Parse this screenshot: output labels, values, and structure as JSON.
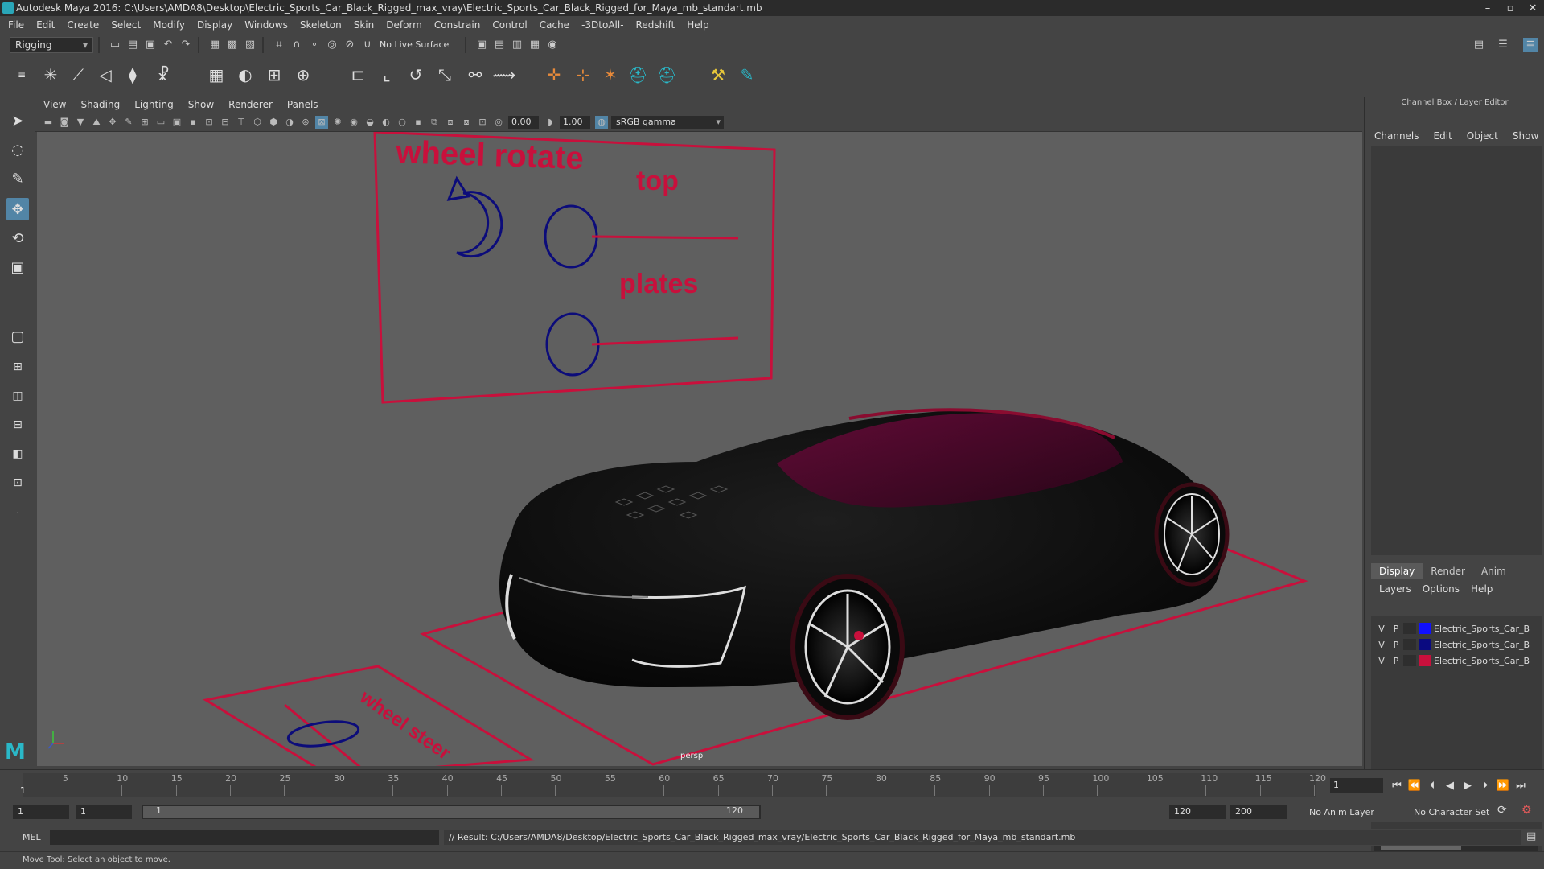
{
  "window": {
    "title": "Autodesk Maya 2016: C:\\Users\\AMDA8\\Desktop\\Electric_Sports_Car_Black_Rigged_max_vray\\Electric_Sports_Car_Black_Rigged_for_Maya_mb_standart.mb",
    "minimize": "–",
    "maximize": "▫",
    "close": "✕"
  },
  "menubar": [
    "File",
    "Edit",
    "Create",
    "Select",
    "Modify",
    "Display",
    "Windows",
    "Skeleton",
    "Skin",
    "Deform",
    "Constrain",
    "Control",
    "Cache",
    "-3DtoAll-",
    "Redshift",
    "Help"
  ],
  "statusline": {
    "mode": "Rigging",
    "live_surface": "No Live Surface"
  },
  "viewport": {
    "menus": [
      "View",
      "Shading",
      "Lighting",
      "Show",
      "Renderer",
      "Panels"
    ],
    "exposure": "0.00",
    "gamma_value": "1.00",
    "color_space": "sRGB gamma",
    "camera": "persp",
    "rig_labels": {
      "wheel_rotate": "wheel rotate",
      "top": "top",
      "plates": "plates",
      "wheel_steer": "wheel steer"
    },
    "colors": {
      "background": "#5f5f5f",
      "control_red": "#c8103c",
      "control_blue": "#0c0c7a"
    }
  },
  "channel_box": {
    "title": "Channel Box / Layer Editor",
    "menus": [
      "Channels",
      "Edit",
      "Object",
      "Show"
    ],
    "tabs": [
      "Display",
      "Render",
      "Anim"
    ],
    "layer_menus": [
      "Layers",
      "Options",
      "Help"
    ],
    "layers": [
      {
        "v": "V",
        "p": "P",
        "color": "#1010ff",
        "name": "Electric_Sports_Car_Bla"
      },
      {
        "v": "V",
        "p": "P",
        "color": "#0a0a80",
        "name": "Electric_Sports_Car_Bla"
      },
      {
        "v": "V",
        "p": "P",
        "color": "#c8103c",
        "name": "Electric_Sports_Car_Bla"
      }
    ]
  },
  "timeline": {
    "ticks": [
      "5",
      "10",
      "15",
      "20",
      "25",
      "30",
      "35",
      "40",
      "45",
      "50",
      "55",
      "60",
      "65",
      "70",
      "75",
      "80",
      "85",
      "90",
      "95",
      "100",
      "105",
      "110",
      "115",
      "120"
    ],
    "current_marker": "1",
    "current_frame": "1"
  },
  "range": {
    "start": "1",
    "playback_start": "1",
    "slider_start": "1",
    "slider_end": "120",
    "playback_end": "120",
    "end": "200",
    "anim_layer": "No Anim Layer",
    "character_set": "No Character Set"
  },
  "command": {
    "language": "MEL",
    "result": "// Result: C:/Users/AMDA8/Desktop/Electric_Sports_Car_Black_Rigged_max_vray/Electric_Sports_Car_Black_Rigged_for_Maya_mb_standart.mb"
  },
  "help_line": "Move Tool: Select an object to move."
}
